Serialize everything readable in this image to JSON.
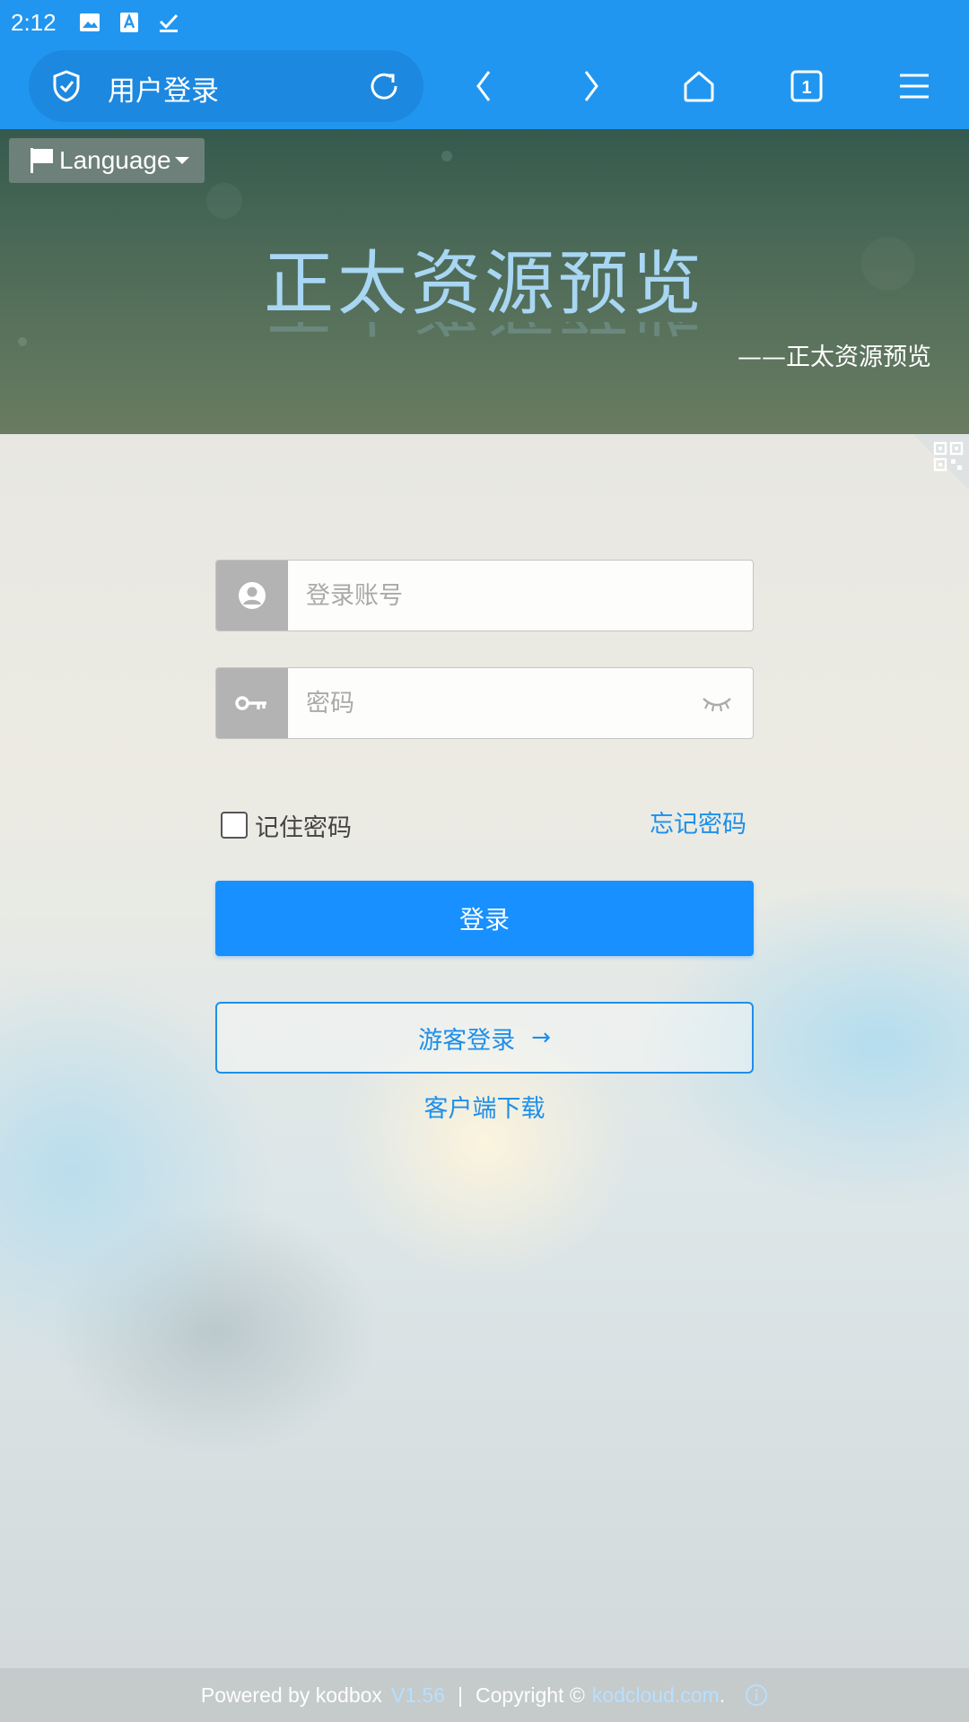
{
  "status_bar": {
    "time": "2:12"
  },
  "browser": {
    "page_title": "用户登录",
    "tab_count": "1"
  },
  "header": {
    "language_label": "Language",
    "site_title": "正太资源预览",
    "subtitle": "——正太资源预览"
  },
  "form": {
    "username_placeholder": "登录账号",
    "password_placeholder": "密码",
    "remember_label": "记住密码",
    "forgot_label": "忘记密码",
    "login_label": "登录",
    "guest_label": "游客登录",
    "guest_arrow": "→",
    "client_download_label": "客户端下载"
  },
  "footer": {
    "powered_by": "Powered by kodbox",
    "version": "V1.56",
    "separator": "|",
    "copyright": "Copyright ©",
    "link": "kodcloud.com",
    "suffix": "."
  },
  "colors": {
    "accent": "#1890ff",
    "toolbar": "#2196f0",
    "title": "#a8d6f3"
  },
  "icons": [
    "image-icon",
    "font-icon",
    "checkmark-icon",
    "shield-icon",
    "reload-icon",
    "back-icon",
    "forward-icon",
    "home-icon",
    "tabs-icon",
    "menu-icon",
    "flag-icon",
    "qrcode-icon",
    "user-icon",
    "key-icon",
    "eye-closed-icon",
    "info-icon"
  ]
}
